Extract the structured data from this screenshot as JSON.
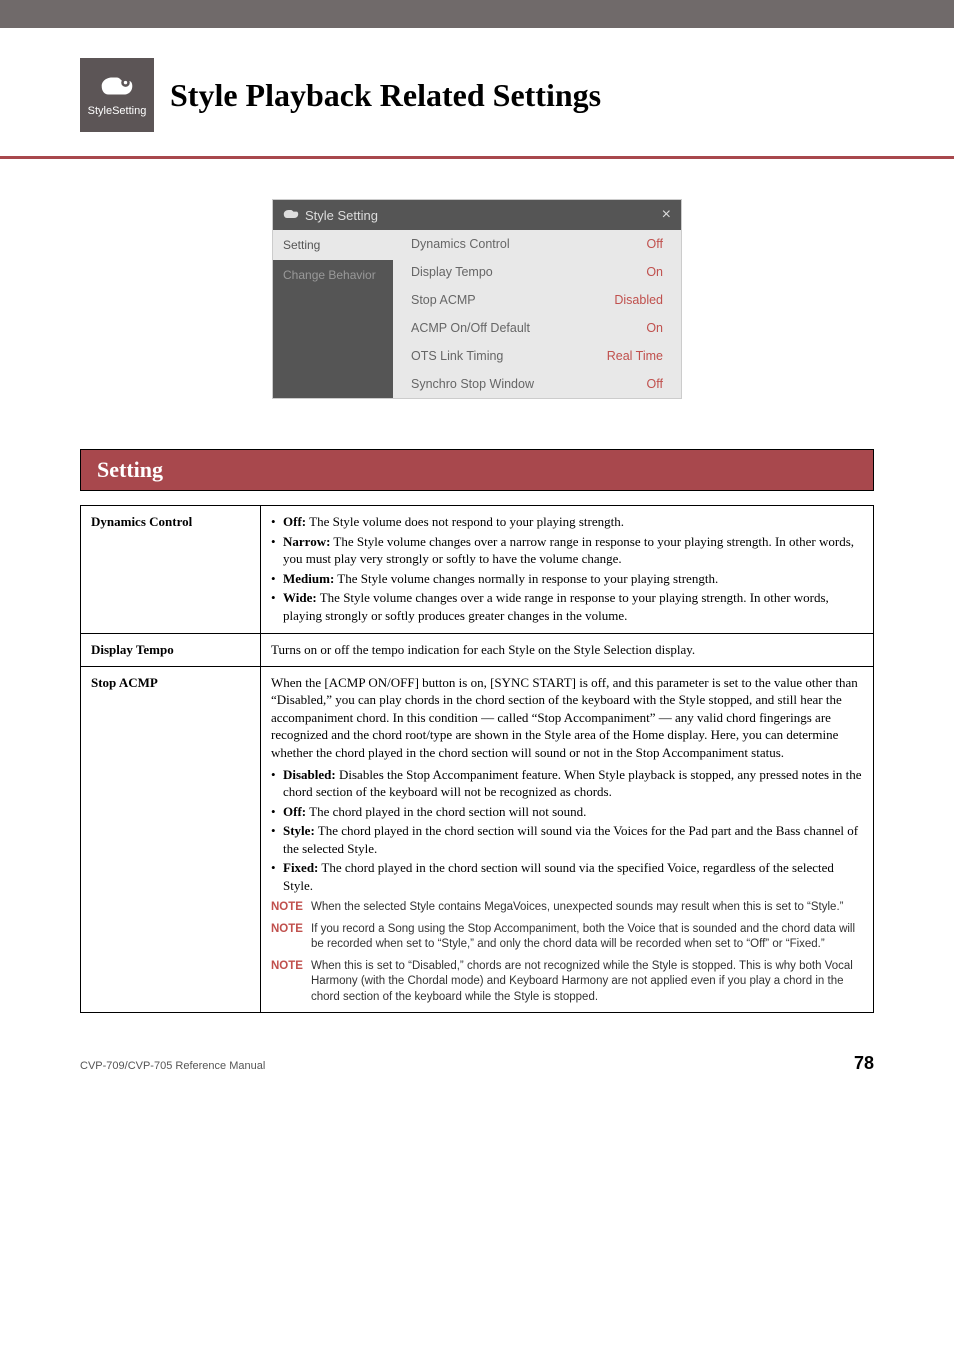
{
  "header": {
    "icon_label": "StyleSetting",
    "title": "Style Playback Related Settings"
  },
  "panel": {
    "title": "Style Setting",
    "close": "×",
    "tabs": {
      "setting": "Setting",
      "change_behavior": "Change Behavior"
    },
    "rows": [
      {
        "label": "Dynamics Control",
        "value": "Off"
      },
      {
        "label": "Display Tempo",
        "value": "On"
      },
      {
        "label": "Stop ACMP",
        "value": "Disabled"
      },
      {
        "label": "ACMP On/Off Default",
        "value": "On"
      },
      {
        "label": "OTS Link Timing",
        "value": "Real Time"
      },
      {
        "label": "Synchro Stop Window",
        "value": "Off"
      }
    ]
  },
  "section_heading": "Setting",
  "desc": {
    "dynamics_control": {
      "label": "Dynamics Control",
      "items": {
        "off": {
          "b": "Off:",
          "t": " The Style volume does not respond to your playing strength."
        },
        "narrow": {
          "b": "Narrow:",
          "t": " The Style volume changes over a narrow range in response to your playing strength. In other words, you must play very strongly or softly to have the volume change."
        },
        "medium": {
          "b": "Medium:",
          "t": " The Style volume changes normally in response to your playing strength."
        },
        "wide": {
          "b": "Wide:",
          "t": " The Style volume changes over a wide range in response to your playing strength. In other words, playing strongly or softly produces greater changes in the volume."
        }
      }
    },
    "display_tempo": {
      "label": "Display Tempo",
      "text": "Turns on or off the tempo indication for each Style on the Style Selection display."
    },
    "stop_acmp": {
      "label": "Stop ACMP",
      "intro": "When the [ACMP ON/OFF] button is on, [SYNC START] is off, and this parameter is set to the value other than “Disabled,” you can play chords in the chord section of the keyboard with the Style stopped, and still hear the accompaniment chord. In this condition — called “Stop Accompaniment” — any valid chord fingerings are recognized and the chord root/type are shown in the Style area of the Home display. Here, you can determine whether the chord played in the chord section will sound or not in the Stop Accompaniment status.",
      "items": {
        "disabled": {
          "b": "Disabled:",
          "t": " Disables the Stop Accompaniment feature. When Style playback is stopped, any pressed notes in the chord section of the keyboard will not be recognized as chords."
        },
        "off": {
          "b": "Off:",
          "t": " The chord played in the chord section will not sound."
        },
        "style": {
          "b": "Style:",
          "t": " The chord played in the chord section will sound via the Voices for the Pad part and the Bass channel of the selected Style."
        },
        "fixed": {
          "b": "Fixed:",
          "t": " The chord played in the chord section will sound via the specified Voice, regardless of the selected Style."
        }
      },
      "notes": {
        "n1": {
          "label": "NOTE",
          "text": "When the selected Style contains MegaVoices, unexpected sounds may result when this is set to “Style.”"
        },
        "n2": {
          "label": "NOTE",
          "text": "If you record a Song using the Stop Accompaniment, both the Voice that is sounded and the chord data will be recorded when set to “Style,” and only the chord data will be recorded when set to “Off” or “Fixed.”"
        },
        "n3": {
          "label": "NOTE",
          "text": "When this is set to “Disabled,” chords are not recognized while the Style is stopped. This is why both Vocal Harmony (with the Chordal mode) and Keyboard Harmony are not applied even if you play a chord in the chord section of the keyboard while the Style is stopped."
        }
      }
    }
  },
  "footer": {
    "left": "CVP-709/CVP-705 Reference Manual",
    "page": "78"
  }
}
